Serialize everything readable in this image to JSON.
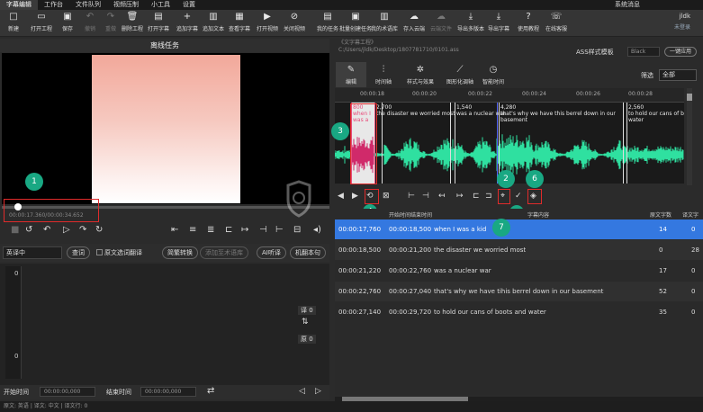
{
  "menubar": {
    "items": [
      "字幕编辑",
      "工作台",
      "文件队列",
      "视频压制",
      "小工具",
      "设置"
    ],
    "active": 0,
    "system_message": "系统消息"
  },
  "toolbar": {
    "items": [
      {
        "label": "新建",
        "icon": "□"
      },
      {
        "label": "打开工程",
        "icon": "▭"
      },
      {
        "label": "保存",
        "icon": "▣"
      },
      {
        "label": "撤销",
        "icon": "↶"
      },
      {
        "label": "重做",
        "icon": "↷"
      },
      {
        "label": "删除工程",
        "icon": "🗑"
      },
      {
        "label": "打开字幕",
        "icon": "▤"
      },
      {
        "label": "追加字幕",
        "icon": "+"
      },
      {
        "label": "追加文本",
        "icon": "▥"
      },
      {
        "label": "查看字幕",
        "icon": "▦"
      },
      {
        "label": "打开视频",
        "icon": "▶"
      },
      {
        "label": "关闭视频",
        "icon": "⊘"
      },
      {
        "label": "我的任务",
        "icon": "▤"
      },
      {
        "label": "批量创建任务",
        "icon": "▣"
      },
      {
        "label": "我的术语库",
        "icon": "▥"
      },
      {
        "label": "存入云端",
        "icon": "☁"
      },
      {
        "label": "云端文件",
        "icon": "☁"
      },
      {
        "label": "导出多版本",
        "icon": "⤓"
      },
      {
        "label": "导出字幕",
        "icon": "⤓"
      },
      {
        "label": "使用教程",
        "icon": "?"
      },
      {
        "label": "在线客服",
        "icon": "☏"
      }
    ]
  },
  "user": {
    "name": "jldk",
    "sub": "未登录"
  },
  "left": {
    "title": "离线任务",
    "timecode": "00:00:17.360/00:00:34.652"
  },
  "badges": {
    "b1": "1",
    "b2": "2",
    "b3": "3",
    "b4": "4",
    "b5": "5",
    "b6": "6",
    "b7": "7"
  },
  "translate": {
    "mode": "英译中",
    "btn_search": "查词",
    "checkbox_label": "原文选词翻译",
    "btn_simpl": "简繁转换",
    "btn_term": "添加至术语库",
    "btn_ai": "AI听译",
    "btn_machine": "机翻本句",
    "line_num_top": "0",
    "line_num_bottom": "0",
    "count_trans": "译 0",
    "count_src": "原 0",
    "start_label": "开始时间",
    "start_value": "00:00:00,000",
    "end_label": "结束时间",
    "end_value": "00:00:00,000"
  },
  "status": "原文: 英语 | 译文: 中文 | 译文行: 0",
  "right": {
    "path_label": "《文字幕工程》",
    "path": "C:/Users/jldk/Desktop/1807781710/0101.ass",
    "ass_label": "ASS样式模板",
    "ass_value": "Black",
    "ass_button": "一键应用",
    "tabs": [
      {
        "label": "编辑",
        "icon": "✎"
      },
      {
        "label": "时间轴",
        "icon": "⫶"
      },
      {
        "label": "样式与效果",
        "icon": "✲"
      },
      {
        "label": "图形化调轴",
        "icon": "⟋"
      },
      {
        "label": "智能时间",
        "icon": "◷"
      }
    ],
    "filter_label": "筛选",
    "filter_value": "全部",
    "ruler": [
      "00:00:18",
      "00:00:20",
      "00:00:22",
      "00:00:24",
      "00:00:26",
      "00:00:28"
    ],
    "cues": [
      {
        "time": "800",
        "text1": "when I",
        "text2": "was a"
      },
      {
        "time": "2,700",
        "text1": "the disaster we worried most",
        "text2": ""
      },
      {
        "time": "1,540",
        "text1": "was a nuclear war",
        "text2": ""
      },
      {
        "time": "4,280",
        "text1": "that's why we have this berrel down in our",
        "text2": "basement"
      },
      {
        "time": "2,560",
        "text1": "to hold our cans of b",
        "text2": "water"
      }
    ],
    "table_headers": [
      "开始时间",
      "结束时间",
      "字幕内容",
      "原文字数",
      "译文字"
    ],
    "rows": [
      {
        "start": "00:00:17,760",
        "end": "00:00:18,500",
        "text": "when I was a kid",
        "n1": "14",
        "n2": "0"
      },
      {
        "start": "00:00:18,500",
        "end": "00:00:21,200",
        "text": "the disaster we worried most",
        "n1": "0",
        "n2": "28"
      },
      {
        "start": "00:00:21,220",
        "end": "00:00:22,760",
        "text": "was a nuclear war",
        "n1": "17",
        "n2": "0"
      },
      {
        "start": "00:00:22,760",
        "end": "00:00:27,040",
        "text": "that's why we have tihis berrel down in our basement",
        "n1": "52",
        "n2": "0"
      },
      {
        "start": "00:00:27,140",
        "end": "00:00:29,720",
        "text": "to hold our cans of boots and water",
        "n1": "35",
        "n2": "0"
      }
    ],
    "selected_row": 0
  },
  "colors": {
    "accent": "#3478e0",
    "badge": "#19a883",
    "highlight": "#e02b2b",
    "wave": "#2fe0a0",
    "wave_active": "#d02a6a"
  }
}
